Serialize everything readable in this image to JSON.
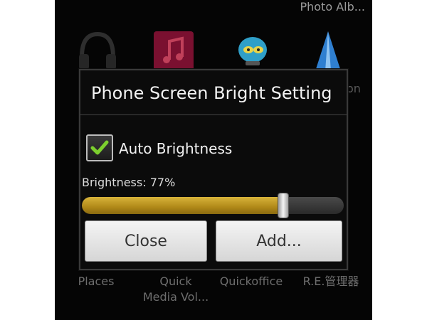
{
  "homescreen": {
    "top_right_label": "Photo Alb...",
    "side_fragment": "on",
    "bottom_labels": {
      "places": "Places",
      "quick_media_line1": "Quick",
      "quick_media_line2": "Media Vol...",
      "quickoffice": "Quickoffice",
      "re_manager": "R.E.管理器"
    }
  },
  "dialog": {
    "title": "Phone Screen Bright Setting",
    "auto_brightness": {
      "label": "Auto Brightness",
      "checked": true
    },
    "brightness": {
      "text": "Brightness: 77%",
      "value": 0.77
    },
    "buttons": {
      "close": "Close",
      "add": "Add..."
    }
  },
  "colors": {
    "slider_fill": "#c9a02a",
    "checkmark": "#7ccf2e"
  }
}
